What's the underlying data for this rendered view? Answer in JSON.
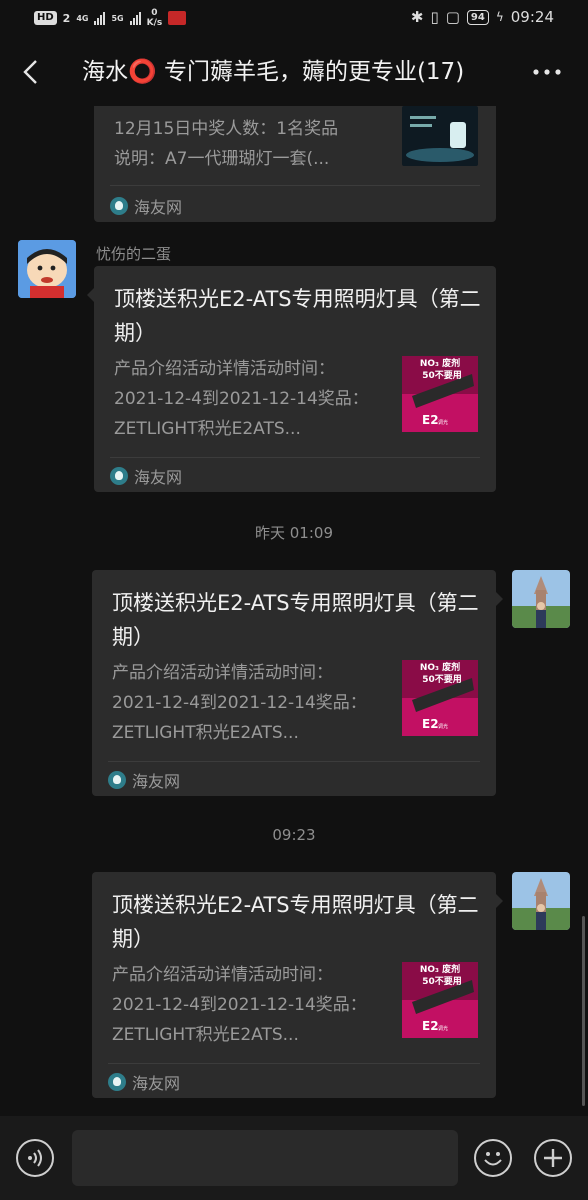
{
  "status_bar": {
    "hd": "HD",
    "sim_number": "2",
    "net1": "4G",
    "net2": "5G",
    "speed_value": "0",
    "speed_unit": "K/s",
    "battery": "94",
    "time": "09:24"
  },
  "nav": {
    "title": "海水⭕ 专门薅羊毛，薅的更专业(17)",
    "back_icon": "chevron-left-icon",
    "more_icon": "more-dots-icon"
  },
  "messages": {
    "top_card": {
      "line1": "12月15日中奖人数：1名奖品",
      "line2": "说明：A7一代珊瑚灯一套(...",
      "source": "海友网"
    },
    "msg1": {
      "sender": "忧伤的二蛋",
      "title": "顶楼送积光E2-ATS专用照明灯具（第二期）",
      "desc": "产品介绍活动详情活动时间：2021-12-4到2021-12-14奖品：ZETLIGHT积光E2ATS...",
      "source": "海友网"
    },
    "time1": "昨天 01:09",
    "msg2": {
      "title": "顶楼送积光E2-ATS专用照明灯具（第二期）",
      "desc": "产品介绍活动详情活动时间：2021-12-4到2021-12-14奖品：ZETLIGHT积光E2ATS...",
      "source": "海友网"
    },
    "time2": "09:23",
    "msg3": {
      "title": "顶楼送积光E2-ATS专用照明灯具（第二期）",
      "desc": "产品介绍活动详情活动时间：2021-12-4到2021-12-14奖品：ZETLIGHT积光E2ATS...",
      "source": "海友网"
    }
  },
  "thumb": {
    "headline1": "NO₃ 废剂",
    "headline2": "50不要用",
    "model": "E2",
    "model_suffix": "调光"
  },
  "input_bar": {
    "voice_icon": "voice-icon",
    "emoji_icon": "emoji-icon",
    "plus_icon": "plus-icon"
  }
}
